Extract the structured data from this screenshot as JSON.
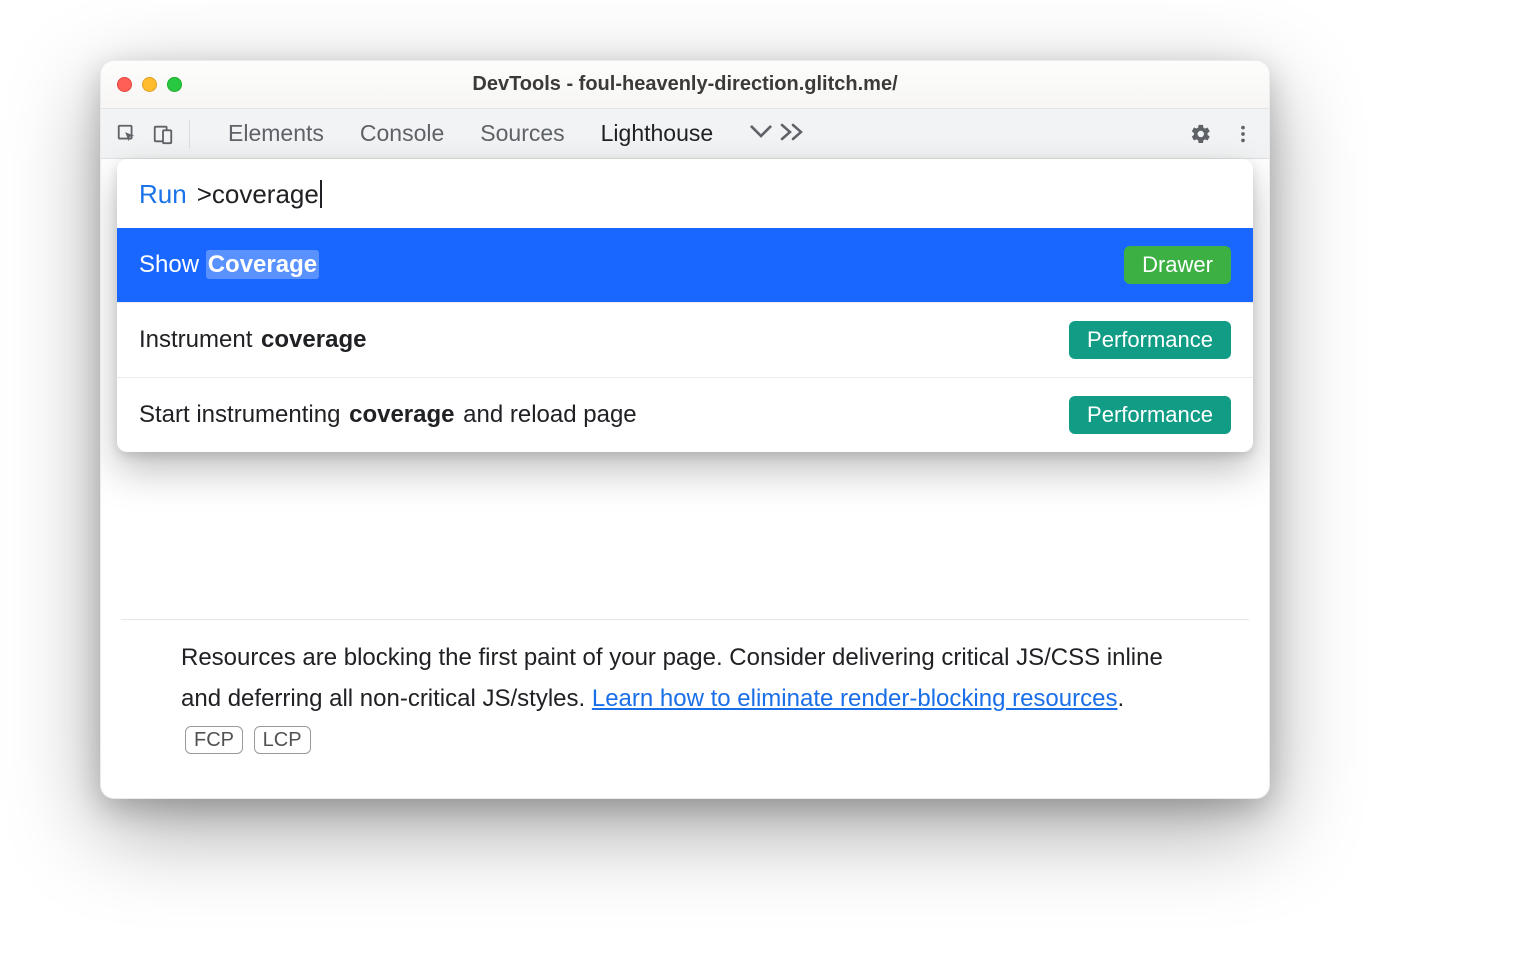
{
  "window": {
    "title": "DevTools - foul-heavenly-direction.glitch.me/"
  },
  "toolbar": {
    "tabs": [
      "Elements",
      "Console",
      "Sources",
      "Lighthouse"
    ],
    "active_tab_index": 3
  },
  "palette": {
    "prompt": "Run",
    "query": ">coverage",
    "items": [
      {
        "prefix": "Show ",
        "highlight": "Coverage",
        "suffix": "",
        "badge": "Drawer",
        "badge_class": "drawer",
        "selected": true
      },
      {
        "prefix": "Instrument ",
        "highlight": "coverage",
        "suffix": "",
        "badge": "Performance",
        "badge_class": "performance",
        "selected": false
      },
      {
        "prefix": "Start instrumenting ",
        "highlight": "coverage",
        "suffix": " and reload page",
        "badge": "Performance",
        "badge_class": "performance",
        "selected": false
      }
    ]
  },
  "description": {
    "text_before_link": "Resources are blocking the first paint of your page. Consider delivering critical JS/CSS inline and deferring all non-critical JS/styles. ",
    "link_text": "Learn how to eliminate render-blocking resources",
    "text_after_link": ". ",
    "chips": [
      "FCP",
      "LCP"
    ]
  }
}
